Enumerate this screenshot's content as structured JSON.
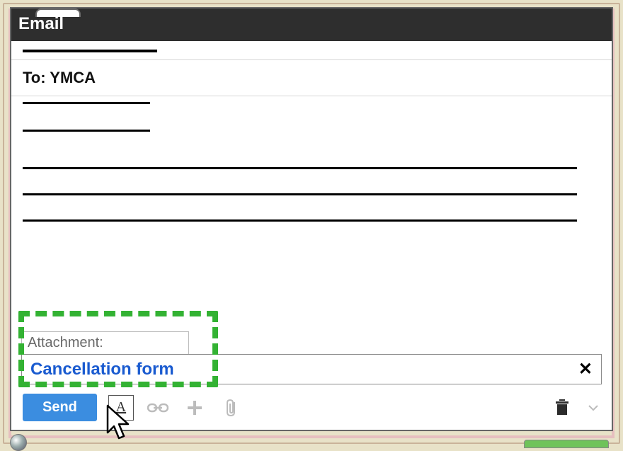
{
  "window": {
    "title": "Email"
  },
  "to": {
    "label": "To:",
    "value": "YMCA"
  },
  "attachment": {
    "label": "Attachment:",
    "file_name": "Cancellation form"
  },
  "toolbar": {
    "send_label": "Send"
  }
}
